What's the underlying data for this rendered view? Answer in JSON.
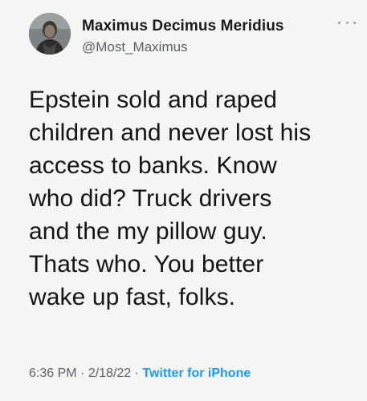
{
  "tweet": {
    "author": {
      "display_name": "Maximus Decimus Meridius",
      "handle": "@Most_Maximus",
      "avatar_icon": "profile-photo"
    },
    "more_icon": "more-horizontal-icon",
    "text": "Epstein sold and raped\nchildren and never lost his\naccess to banks. Know\nwho did? Truck drivers\nand the my pillow guy.\nThats who. You better\nwake up fast, folks.",
    "time": "6:36 PM",
    "separator": " · ",
    "date": "2/18/22",
    "source": "Twitter for iPhone",
    "colors": {
      "link": "#1d9bf0",
      "meta": "#5b6369",
      "background": "#f5f5f3"
    }
  }
}
